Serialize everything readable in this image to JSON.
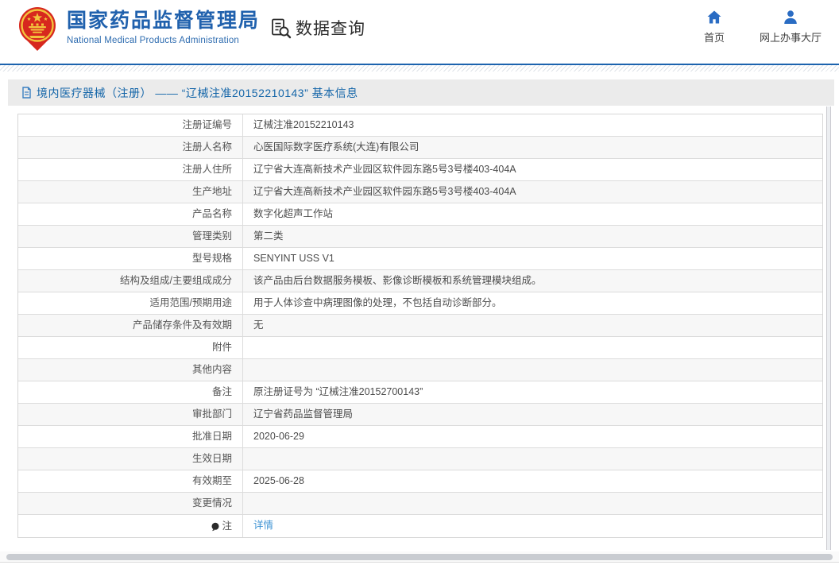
{
  "header": {
    "brand": {
      "title": "国家药品监督管理局",
      "subtitle": "National Medical Products Administration"
    },
    "query_section_label": "数据查询",
    "nav": {
      "home": "首页",
      "service_hall": "网上办事大厅"
    }
  },
  "breadcrumb": {
    "title": "境内医疗器械（注册） —— “辽械注准20152210143” 基本信息"
  },
  "detail_table": {
    "rows": [
      {
        "label": "注册证编号",
        "value": "辽械注准20152210143"
      },
      {
        "label": "注册人名称",
        "value": "心医国际数字医疗系统(大连)有限公司"
      },
      {
        "label": "注册人住所",
        "value": "辽宁省大连高新技术产业园区软件园东路5号3号楼403-404A"
      },
      {
        "label": "生产地址",
        "value": "辽宁省大连高新技术产业园区软件园东路5号3号楼403-404A"
      },
      {
        "label": "产品名称",
        "value": "数字化超声工作站"
      },
      {
        "label": "管理类别",
        "value": "第二类"
      },
      {
        "label": "型号规格",
        "value": "SENYINT USS V1"
      },
      {
        "label": "结构及组成/主要组成成分",
        "value": "该产品由后台数据服务模板、影像诊断模板和系统管理模块组成。"
      },
      {
        "label": "适用范围/预期用途",
        "value": "用于人体诊查中病理图像的处理，不包括自动诊断部分。"
      },
      {
        "label": "产品储存条件及有效期",
        "value": "无"
      },
      {
        "label": "附件",
        "value": ""
      },
      {
        "label": "其他内容",
        "value": ""
      },
      {
        "label": "备注",
        "value": "原注册证号为 “辽械注准20152700143”"
      },
      {
        "label": "审批部门",
        "value": "辽宁省药品监督管理局"
      },
      {
        "label": "批准日期",
        "value": "2020-06-29"
      },
      {
        "label": "生效日期",
        "value": ""
      },
      {
        "label": "有效期至",
        "value": "2025-06-28"
      },
      {
        "label": "变更情况",
        "value": ""
      },
      {
        "label": "注",
        "value": "详情",
        "value_is_link": true,
        "label_icon": "note-icon"
      }
    ]
  },
  "colors": {
    "brand_blue": "#2061ad",
    "rule_blue": "#1c63ae",
    "crumb_text_blue": "#1566a9",
    "link_blue": "#4094d4",
    "alt_row_bg": "#f7f7f7",
    "crumb_bg": "#ebebeb"
  }
}
